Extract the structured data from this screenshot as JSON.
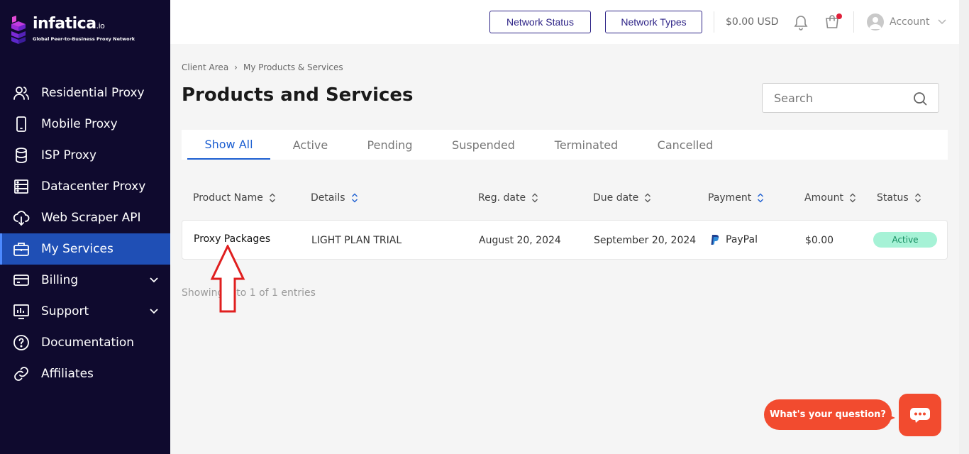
{
  "brand": {
    "name": "infatica",
    "suffix": ".io",
    "tagline": "Global Peer-to-Business Proxy Network"
  },
  "sidebar": {
    "items": [
      {
        "label": "Residential Proxy",
        "icon": "users-icon"
      },
      {
        "label": "Mobile Proxy",
        "icon": "mobile-icon"
      },
      {
        "label": "ISP Proxy",
        "icon": "database-icon"
      },
      {
        "label": "Datacenter Proxy",
        "icon": "server-icon"
      },
      {
        "label": "Web Scraper API",
        "icon": "cloud-download-icon"
      },
      {
        "label": "My Services",
        "icon": "briefcase-icon",
        "active": true
      },
      {
        "label": "Billing",
        "icon": "credit-card-icon",
        "expandable": true
      },
      {
        "label": "Support",
        "icon": "support-chart-icon",
        "expandable": true
      },
      {
        "label": "Documentation",
        "icon": "help-circle-icon"
      },
      {
        "label": "Affiliates",
        "icon": "link-icon"
      }
    ]
  },
  "topbar": {
    "network_status_label": "Network Status",
    "network_types_label": "Network Types",
    "balance": "$0.00 USD",
    "account_label": "Account"
  },
  "breadcrumb": {
    "root": "Client Area",
    "separator": "›",
    "current": "My Products & Services"
  },
  "page": {
    "title": "Products and Services"
  },
  "search": {
    "placeholder": "Search"
  },
  "tabs": [
    {
      "label": "Show All",
      "active": true
    },
    {
      "label": "Active"
    },
    {
      "label": "Pending"
    },
    {
      "label": "Suspended"
    },
    {
      "label": "Terminated"
    },
    {
      "label": "Cancelled"
    }
  ],
  "table": {
    "headers": [
      "Product Name",
      "Details",
      "Reg. date",
      "Due date",
      "Payment",
      "Amount",
      "Status"
    ],
    "rows": [
      {
        "name": "Proxy Packages",
        "details": "LIGHT PLAN TRIAL",
        "reg_date": "August 20, 2024",
        "due_date": "September 20, 2024",
        "payment": "PayPal",
        "amount": "$0.00",
        "status": "Active"
      }
    ],
    "entries_text": "Showing 1 to 1 of 1 entries"
  },
  "chat": {
    "prompt": "What's your question?"
  },
  "colors": {
    "sidebar_bg": "#0f0a2e",
    "active_nav": "#1f4fb5",
    "accent": "#1d5fd1",
    "brand_button": "#2e2487",
    "status_active_bg": "#a6f2d6",
    "chat": "#f24b2f",
    "annotation_arrow": "#e01f1f"
  }
}
